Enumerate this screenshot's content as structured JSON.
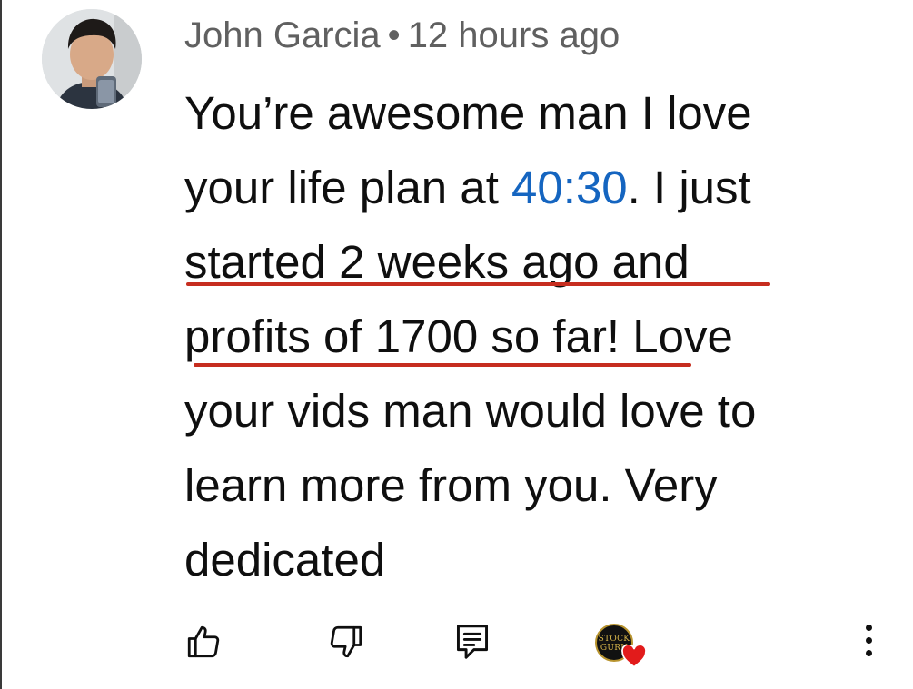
{
  "comment": {
    "author": "John Garcia",
    "separator": "•",
    "time_ago": "12 hours ago",
    "text_lines": [
      {
        "before": "You’re awesome man I love"
      },
      {
        "before": "your life plan at ",
        "link": "40:30",
        "after": ". I just"
      },
      {
        "before": "started 2 weeks ago and"
      },
      {
        "before": "profits of 1700 so far! Love"
      },
      {
        "before": "your vids man would love to"
      },
      {
        "before": "learn more from you. Very"
      },
      {
        "before": "dedicated"
      }
    ]
  },
  "actions": {
    "like_icon": "thumbs-up-icon",
    "dislike_icon": "thumbs-down-icon",
    "reply_icon": "reply-comment-icon",
    "creator_heart": {
      "channel_badge_text": [
        "STOCK",
        "GURU"
      ],
      "heart_icon": "heart-icon",
      "heart_color": "#e21b1b"
    },
    "more_icon": "more-vertical-icon"
  },
  "colors": {
    "link": "#1565c0",
    "meta_text": "#606060",
    "annotation_underline": "#c62d1f"
  }
}
